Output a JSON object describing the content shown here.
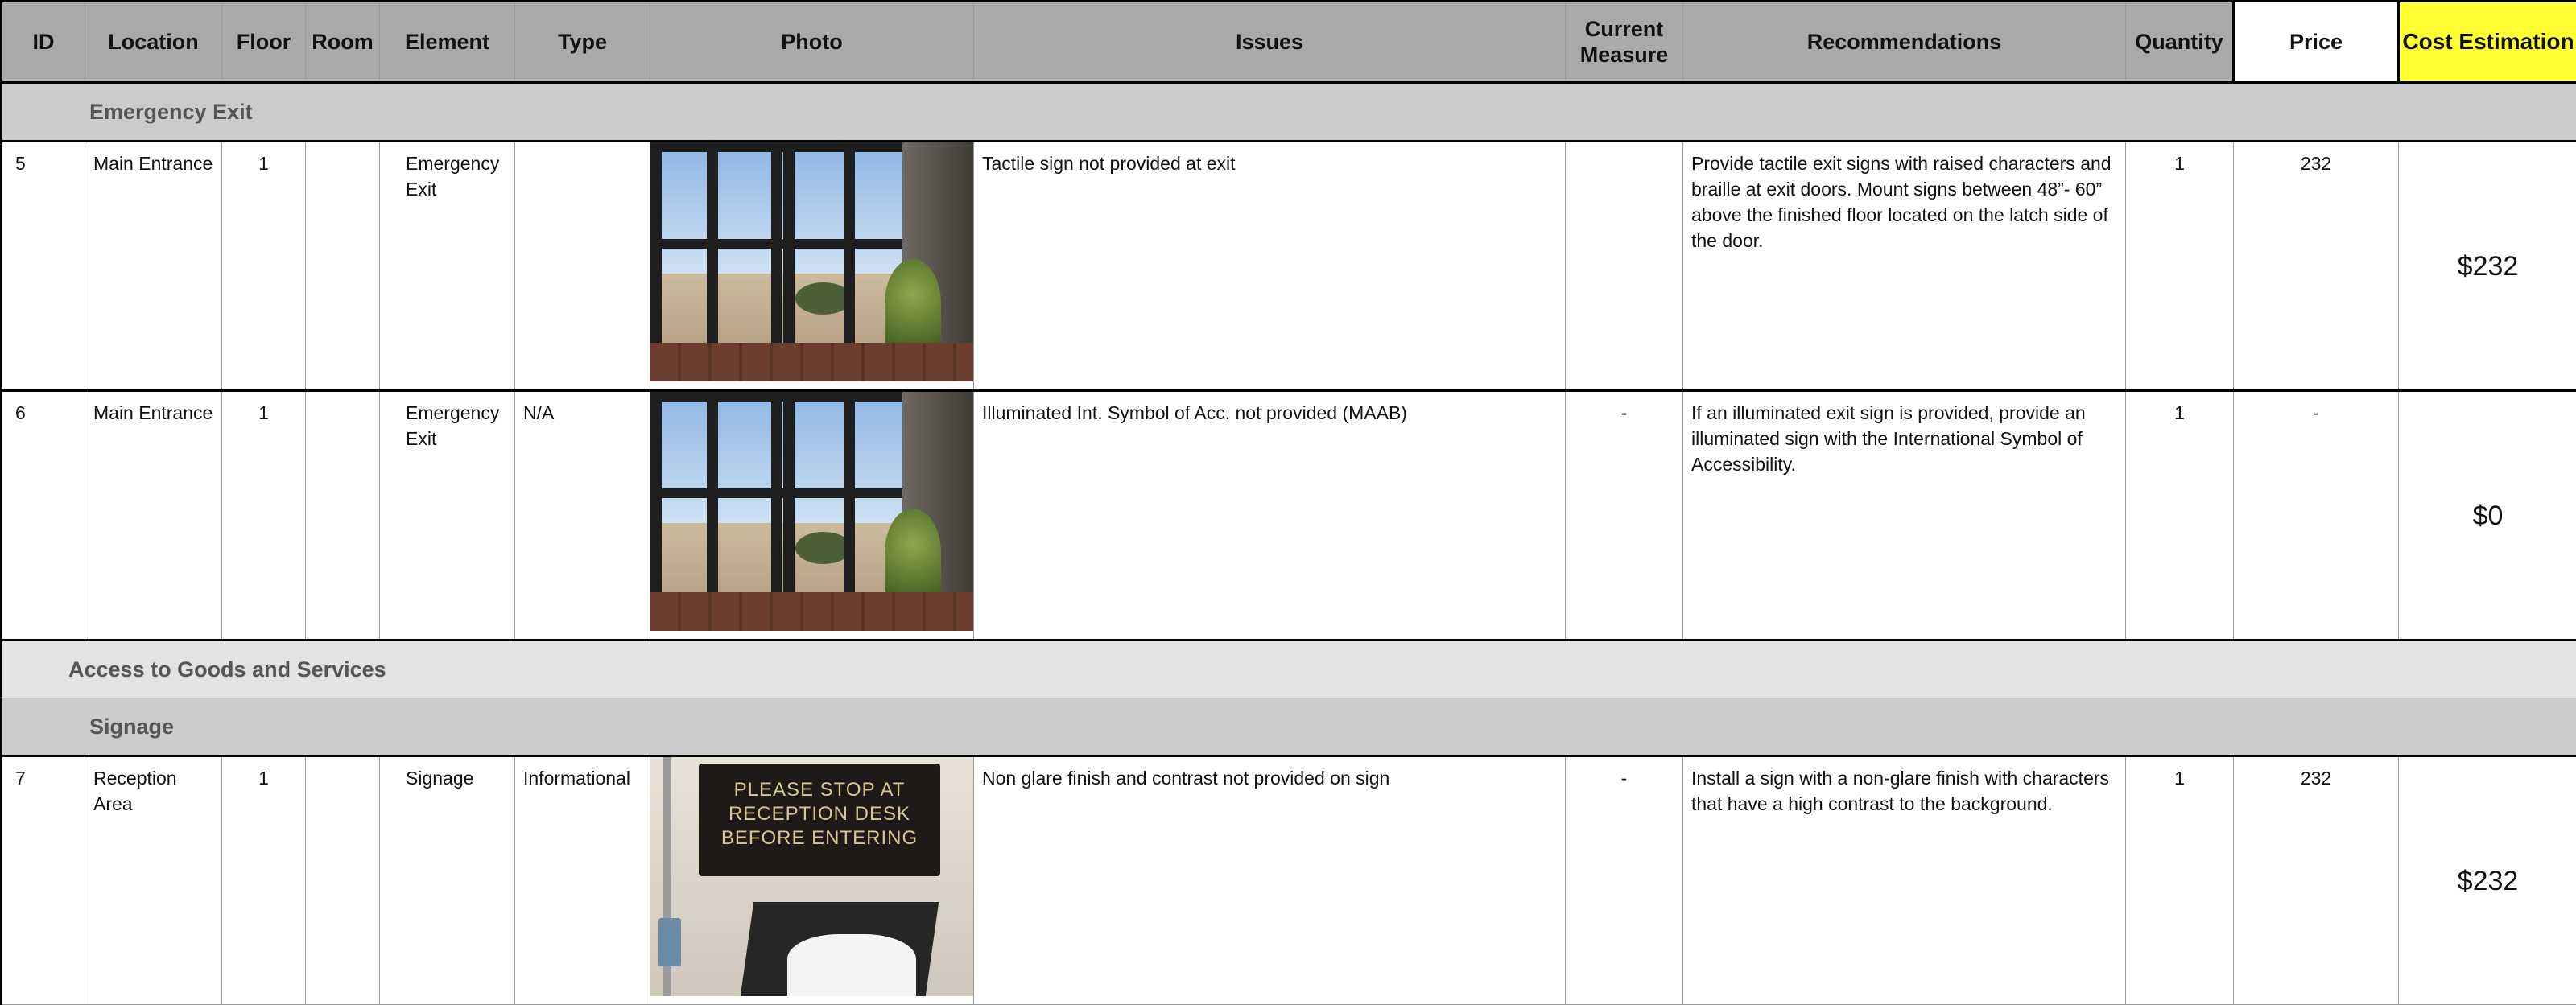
{
  "header": {
    "id": "ID",
    "location": "Location",
    "floor": "Floor",
    "room": "Room",
    "element": "Element",
    "type": "Type",
    "photo": "Photo",
    "issues": "Issues",
    "current_measure": "Current Measure",
    "recommendations": "Recommendations",
    "quantity": "Quantity",
    "price": "Price",
    "cost_estimation": "Cost Estimation"
  },
  "sections": {
    "emergency_exit": "Emergency Exit",
    "access_goods_services": "Access to Goods and Services",
    "signage": "Signage"
  },
  "rows": [
    {
      "id": "5",
      "location": "Main Entrance",
      "floor": "1",
      "room": "",
      "element": "Emergency Exit",
      "type": "",
      "photo_icon": "glass-door-photo",
      "issues": "Tactile sign not provided at exit",
      "current_measure": "",
      "recommendations": "Provide tactile exit signs with raised characters and braille at exit doors. Mount signs between 48”- 60” above the finished floor located on the latch side of the door.",
      "quantity": "1",
      "price": "232",
      "cost": "$232"
    },
    {
      "id": "6",
      "location": "Main Entrance",
      "floor": "1",
      "room": "",
      "element": "Emergency Exit",
      "type": "N/A",
      "photo_icon": "glass-door-photo",
      "issues": "Illuminated Int. Symbol of Acc. not provided (MAAB)",
      "current_measure": "-",
      "recommendations": "If an illuminated exit sign is provided, provide an illuminated sign with the International Symbol of Accessibility.",
      "quantity": "1",
      "price": "-",
      "cost": "$0"
    },
    {
      "id": "7",
      "location": "Reception Area",
      "floor": "1",
      "room": "",
      "element": "Signage",
      "type": "Informational",
      "photo_icon": "reception-sign-photo",
      "photo_sign_text": [
        "PLEASE STOP AT",
        "RECEPTION DESK",
        "BEFORE ENTERING"
      ],
      "issues": "Non glare finish and contrast not provided on sign",
      "current_measure": "-",
      "recommendations": "Install a sign with a non-glare finish with characters that have a high contrast to the background.",
      "quantity": "1",
      "price": "232",
      "cost": "$232"
    }
  ],
  "colors": {
    "header_bg": "#a9a9a9",
    "cost_header_bg": "#ffff33",
    "section_bg": "#cccccc",
    "group_bg": "#e3e3e3"
  }
}
